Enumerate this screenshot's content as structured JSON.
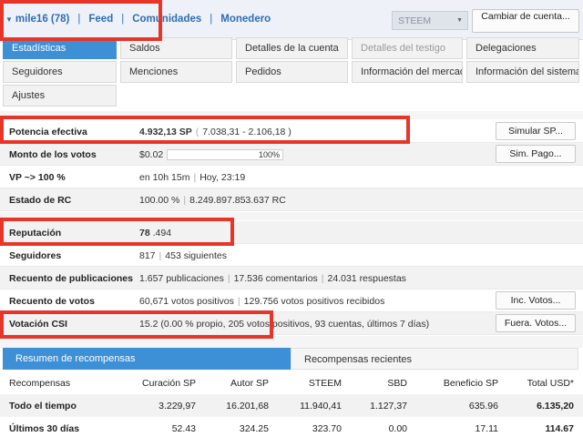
{
  "nav": {
    "account": "mile16 (78)",
    "feed": "Feed",
    "communities": "Comunidades",
    "wallet": "Monedero",
    "coin": "STEEM",
    "switch_account": "Cambiar de cuenta..."
  },
  "tabs": [
    {
      "label": "Estadísticas",
      "active": true
    },
    {
      "label": "Saldos"
    },
    {
      "label": "Detalles de la cuenta"
    },
    {
      "label": "Detalles del testigo",
      "disabled": true
    },
    {
      "label": "Delegaciones"
    },
    {
      "label": "Seguidores"
    },
    {
      "label": "Menciones"
    },
    {
      "label": "Pedidos"
    },
    {
      "label": "Información del mercado"
    },
    {
      "label": "Información del sistema"
    },
    {
      "label": "Ajustes"
    }
  ],
  "stats": {
    "effective_power": {
      "label": "Potencia efectiva",
      "value": "4.932,13 SP",
      "detail_open": "(",
      "detail": "7.038,31",
      "detail_sub": "- 2.106,18",
      "detail_close": ")",
      "button": "Simular SP..."
    },
    "vote_amount": {
      "label": "Monto de los votos",
      "value": "$0.02",
      "percent_label": "100%",
      "percent": 100,
      "button": "Sim. Pago..."
    },
    "vp": {
      "label": "VP ~> 100 %",
      "value": "en 10h 15m",
      "time": "Hoy, 23:19"
    },
    "rc": {
      "label": "Estado de RC",
      "value": "100.00 %",
      "detail": "8.249.897.853.637 RC"
    },
    "reputation": {
      "label": "Reputación",
      "value": "78",
      "decimal": ".494"
    },
    "followers": {
      "label": "Seguidores",
      "value": "817",
      "detail": "453 siguientes"
    },
    "posts": {
      "label": "Recuento de publicaciones",
      "a": "1.657 publicaciones",
      "b": "17.536 comentarios",
      "c": "24.031 respuestas"
    },
    "votes": {
      "label": "Recuento de votos",
      "a": "60,671 votos positivos",
      "b": "129.756 votos positivos recibidos",
      "button": "Inc. Votos..."
    },
    "csi": {
      "label": "Votación CSI",
      "value": "15.2",
      "detail": "(0.00 % propio, 205 votos positivos, 93 cuentas, últimos 7 días)",
      "button": "Fuera. Votos..."
    }
  },
  "rewards": {
    "tab_summary": "Resumen de recompensas",
    "tab_recent": "Recompensas recientes",
    "headers": [
      "Recompensas",
      "Curación SP",
      "Autor SP",
      "STEEM",
      "SBD",
      "Beneficio SP",
      "Total USD*"
    ],
    "rows": [
      {
        "label": "Todo el tiempo",
        "curation": "3.229,97",
        "author": "16.201,68",
        "steem": "11.940,41",
        "sbd": "1.127,37",
        "benefit": "635.96",
        "total": "6.135,20"
      },
      {
        "label": "Últimos 30 días",
        "curation": "52.43",
        "author": "324.25",
        "steem": "323.70",
        "sbd": "0.00",
        "benefit": "17.11",
        "total": "114.67"
      }
    ]
  },
  "colors": {
    "accent": "#3d8fd6",
    "highlight": "#e8352a",
    "link": "#2f6db5"
  }
}
